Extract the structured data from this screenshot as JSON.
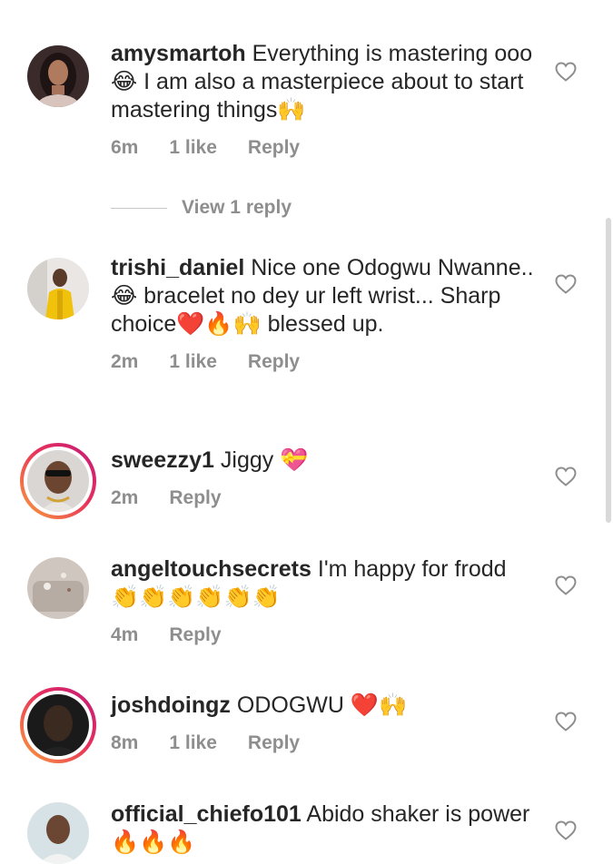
{
  "comments": [
    {
      "username": "amysmartoh",
      "text": "Everything is mastering ooo😂 I am also a masterpiece about to start mastering things🙌",
      "time": "6m",
      "likes": "1 like",
      "reply": "Reply",
      "avatar_icon": "woman-portrait",
      "view_replies": "View 1 reply"
    },
    {
      "username": "trishi_daniel",
      "text": "Nice one Odogwu Nwanne..😂 bracelet no dey ur left wrist... Sharp choice❤️🔥🙌 blessed up.",
      "time": "2m",
      "likes": "1 like",
      "reply": "Reply",
      "avatar_icon": "man-yellow-outfit"
    },
    {
      "username": "sweezzy1",
      "text": "Jiggy 💝",
      "time": "2m",
      "reply": "Reply",
      "avatar_icon": "man-sunglasses-story-ring"
    },
    {
      "username": "angeltouchsecrets",
      "text": "I'm happy for frodd 👏👏👏👏👏👏",
      "time": "4m",
      "reply": "Reply",
      "avatar_icon": "product-photo"
    },
    {
      "username": "joshdoingz",
      "text": "ODOGWU ❤️🙌",
      "time": "8m",
      "likes": "1 like",
      "reply": "Reply",
      "avatar_icon": "man-dark-story-ring"
    },
    {
      "username": "official_chiefo101",
      "text": "Abido shaker is power 🔥🔥🔥",
      "avatar_icon": "man-smiling"
    }
  ],
  "colors": {
    "text": "#262626",
    "secondary": "#8e8e8e",
    "story_ring_start": "#f9a23a",
    "story_ring_end": "#c2197a"
  }
}
